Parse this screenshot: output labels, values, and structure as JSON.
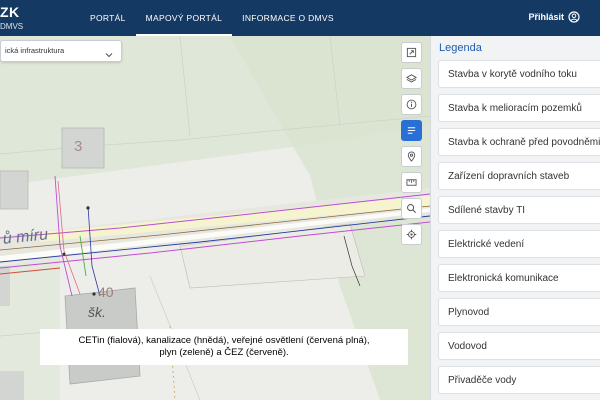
{
  "brand": {
    "code": "ZK",
    "sub": "DMVS"
  },
  "nav": {
    "items": [
      {
        "label": "PORTÁL"
      },
      {
        "label": "MAPOVÝ PORTÁL"
      },
      {
        "label": "INFORMACE O DMVS"
      }
    ],
    "active": "MAPOVÝ PORTÁL"
  },
  "login": {
    "label": "Přihlásit",
    "icon": "user-circle-icon"
  },
  "map": {
    "layer_select": {
      "value": "ická infrastruktura"
    },
    "labels": {
      "building_number_1": "3",
      "building_number_2": "40",
      "street": "ů míru",
      "abbrev": "šk."
    },
    "tools": [
      {
        "name": "fullscreen-icon"
      },
      {
        "name": "layers-icon"
      },
      {
        "name": "info-icon"
      },
      {
        "name": "legend-icon",
        "active": true
      },
      {
        "name": "location-pin-icon"
      },
      {
        "name": "measure-icon"
      },
      {
        "name": "search-icon"
      },
      {
        "name": "geolocate-icon"
      }
    ],
    "caption": {
      "line1": "CETin (fialová), kanalizace (hnědá), veřejné osvětlení (červená plná),",
      "line2": "plyn (zeleně) a ČEZ (červeně)."
    }
  },
  "legend": {
    "title": "Legenda",
    "items": [
      "Stavba v korytě vodního toku",
      "Stavba k melioracím pozemků",
      "Stavba k ochraně před povodněmi",
      "Zařízení dopravních staveb",
      "Sdílené stavby TI",
      "Elektrické vedení",
      "Elektronická komunikace",
      "Plynovod",
      "Vodovod",
      "Přivaděče vody"
    ]
  },
  "colors": {
    "header": "#143a63",
    "accent": "#2a6fd6",
    "legend_title": "#1f5fb0"
  }
}
